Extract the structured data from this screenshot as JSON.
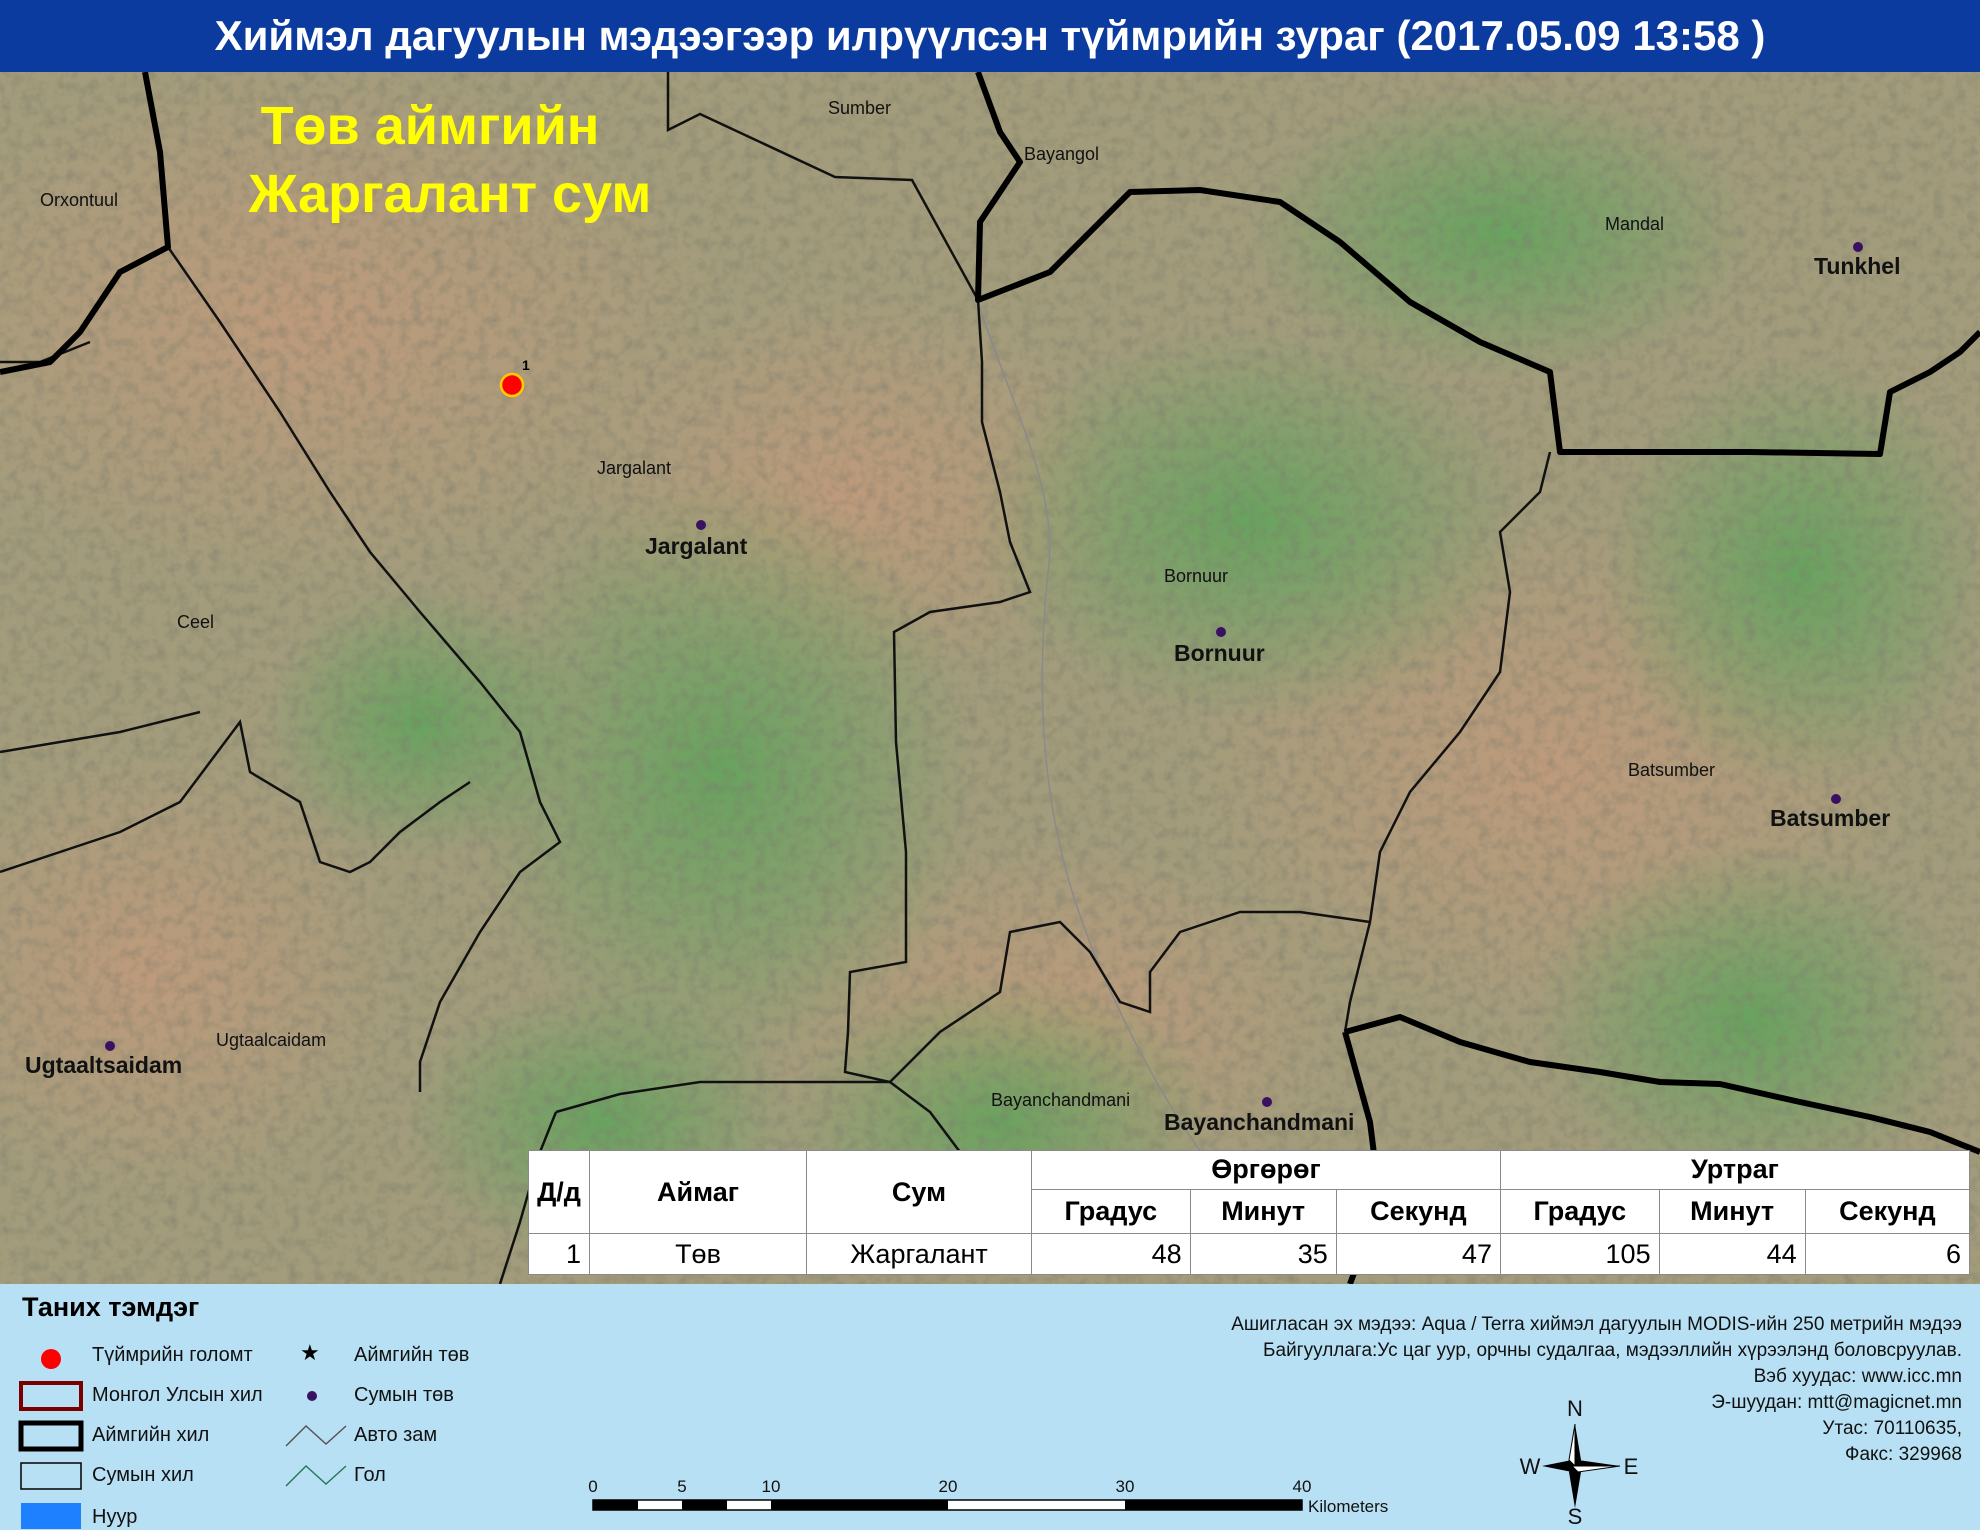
{
  "title": "Хиймэл дагуулын мэдээгээр илрүүлсэн түймрийн зураг  (2017.05.09 13:58 )",
  "map": {
    "region_title_line1": "Төв аймгийн",
    "region_title_line2": "Жаргалант сум",
    "fire_point_label": "1",
    "soum_labels": [
      "Orxontuul",
      "Sumber",
      "Bayangol",
      "Mandal",
      "Jargalant",
      "Ceel",
      "Bornuur",
      "Batsumber",
      "Ugtaalcaidam",
      "Bayanchandmani"
    ],
    "centers": [
      "Tunkhel",
      "Jargalant",
      "Bornuur",
      "Batsumber",
      "Ugtaaltsaidam",
      "Bayanchandmani"
    ]
  },
  "table": {
    "col_no": "Д/д",
    "col_aimag": "Аймаг",
    "col_sum": "Сум",
    "col_lat": "Өргөрөг",
    "col_lon": "Уртраг",
    "sub_deg": "Градус",
    "sub_min": "Минут",
    "sub_sec": "Секунд",
    "rows": [
      {
        "no": "1",
        "aimag": "Төв",
        "sum": "Жаргалант",
        "lat_deg": "48",
        "lat_min": "35",
        "lat_sec": "47",
        "lon_deg": "105",
        "lon_min": "44",
        "lon_sec": "6"
      }
    ]
  },
  "legend": {
    "title": "Таних тэмдэг",
    "items": {
      "fire": "Түймрийн голомт",
      "country_border": "Монгол Улсын хил",
      "aimag_border": "Аймгийн хил",
      "sum_border": "Сумын хил",
      "lake": "Нуур",
      "aimag_center": "Аймгийн төв",
      "sum_center": "Сумын төв",
      "road": "Авто зам",
      "river": "Гол"
    }
  },
  "scale": {
    "ticks": [
      "0",
      "5",
      "10",
      "20",
      "30",
      "40"
    ],
    "unit": "Kilometers"
  },
  "compass": {
    "n": "N",
    "s": "S",
    "e": "E",
    "w": "W"
  },
  "source": {
    "line1": "Ашигласан эх мэдээ: Aqua / Terra хиймэл дагуулын MODIS-ийн 250 метрийн мэдээ",
    "line2": "Байгууллага:Ус цаг уур, орчны судалгаа, мэдээллийн хүрээлэнд боловсруулав.",
    "line3": "Вэб хуудас: www.icc.mn",
    "line4": "Э-шуудан: mtt@magicnet.mn",
    "line5": "Утас: 70110635,",
    "line6": "Факс: 329968"
  },
  "colors": {
    "title_bg": "#0b3b9e",
    "region_title": "#ffff00",
    "fire": "#ff0000",
    "center_dot": "#3a1060",
    "legend_bg": "#b8e0f4",
    "lake": "#1e7fff"
  }
}
